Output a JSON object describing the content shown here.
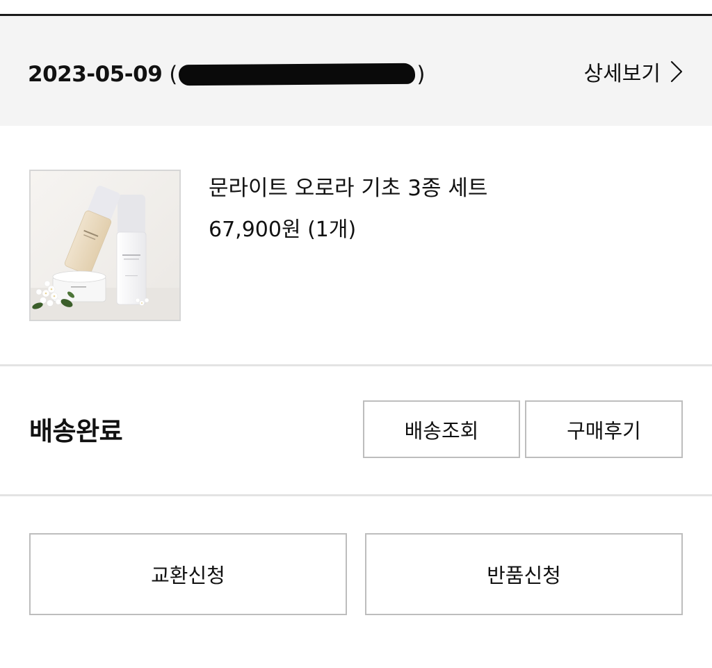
{
  "order": {
    "date": "2023-05-09",
    "number_open": "(",
    "number_close": ")",
    "detail_label": "상세보기",
    "detail_icon": "chevron-right-icon"
  },
  "product": {
    "name": "문라이트 오로라 기초 3종 세트",
    "price": "67,900원 (1개)",
    "image": "product-thumbnail"
  },
  "delivery": {
    "status": "배송완료",
    "track_label": "배송조회",
    "review_label": "구매후기"
  },
  "actions": {
    "exchange_label": "교환신청",
    "return_label": "반품신청"
  },
  "colors": {
    "header_bg": "#f4f4f4",
    "border": "#bdbdbd",
    "divider": "#e3e3e3",
    "text": "#111111"
  }
}
